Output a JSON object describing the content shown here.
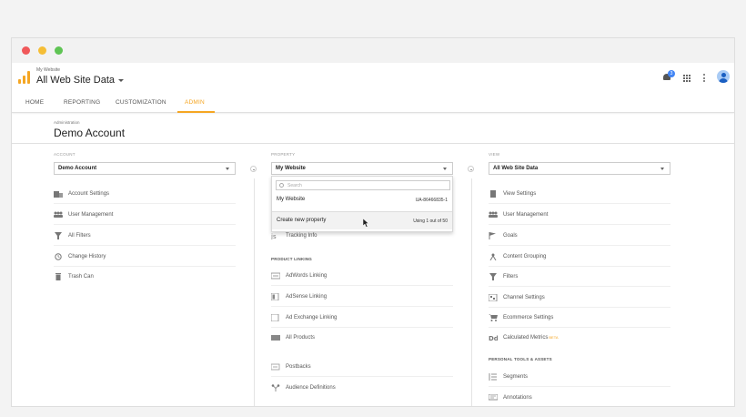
{
  "app": {
    "account_small": "My Website",
    "view_title": "All Web Site Data",
    "notification_count": "3"
  },
  "tabs": [
    {
      "label": "HOME"
    },
    {
      "label": "REPORTING"
    },
    {
      "label": "CUSTOMIZATION"
    },
    {
      "label": "ADMIN"
    }
  ],
  "header": {
    "breadcrumb": "Administration",
    "title": "Demo Account"
  },
  "account": {
    "label": "ACCOUNT",
    "selected": "Demo Account",
    "items": [
      {
        "label": "Account Settings",
        "icon": "building-icon"
      },
      {
        "label": "User Management",
        "icon": "users-icon"
      },
      {
        "label": "All Filters",
        "icon": "filter-icon"
      },
      {
        "label": "Change History",
        "icon": "history-icon"
      },
      {
        "label": "Trash Can",
        "icon": "trash-icon"
      }
    ]
  },
  "property": {
    "label": "PROPERTY",
    "selected": "My Website",
    "dropdown": {
      "search_placeholder": "Search",
      "option_name": "My Website",
      "option_id": "UA-86466835-1",
      "create_label": "Create new property",
      "create_usage": "Using 1 out of 50"
    },
    "items": [
      {
        "label": "Tracking Info",
        "icon": "code-icon"
      }
    ],
    "section": "PRODUCT LINKING",
    "linking": [
      {
        "label": "AdWords Linking",
        "icon": "adwords-icon"
      },
      {
        "label": "AdSense Linking",
        "icon": "adsense-icon"
      },
      {
        "label": "Ad Exchange Linking",
        "icon": "adexchange-icon"
      },
      {
        "label": "All Products",
        "icon": "products-icon"
      }
    ],
    "extra": [
      {
        "label": "Postbacks",
        "icon": "postbacks-icon"
      },
      {
        "label": "Audience Definitions",
        "icon": "audience-icon"
      }
    ]
  },
  "view": {
    "label": "VIEW",
    "selected": "All Web Site Data",
    "items": [
      {
        "label": "View Settings",
        "icon": "document-icon"
      },
      {
        "label": "User Management",
        "icon": "users-icon"
      },
      {
        "label": "Goals",
        "icon": "flag-icon"
      },
      {
        "label": "Content Grouping",
        "icon": "grouping-icon"
      },
      {
        "label": "Filters",
        "icon": "filter-icon"
      },
      {
        "label": "Channel Settings",
        "icon": "channel-icon"
      },
      {
        "label": "Ecommerce Settings",
        "icon": "cart-icon"
      },
      {
        "label": "Calculated Metrics",
        "icon": "dd-icon",
        "badge": "BETA"
      }
    ],
    "section": "PERSONAL TOOLS & ASSETS",
    "tools": [
      {
        "label": "Segments",
        "icon": "segments-icon"
      },
      {
        "label": "Annotations",
        "icon": "annotation-icon"
      }
    ]
  },
  "colors": {
    "accent": "#f5a623",
    "badge": "#4285f4"
  }
}
